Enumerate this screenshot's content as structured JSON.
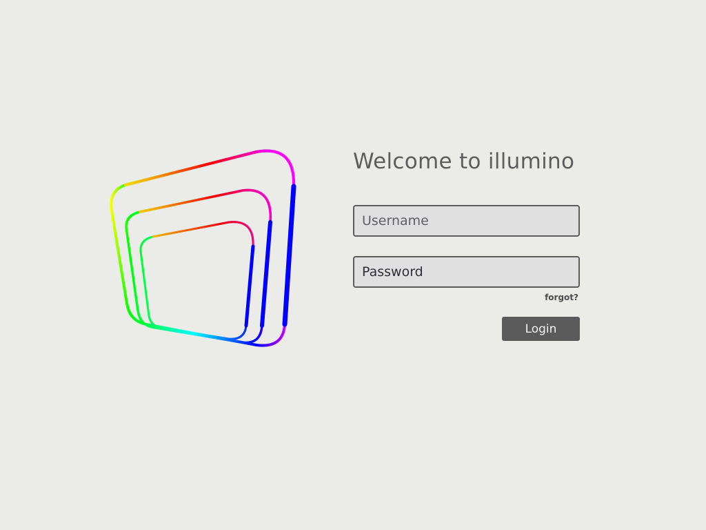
{
  "logo": {
    "icon": "rainbow-nested-squares-logo",
    "colors": [
      "#ffff00",
      "#00ff00",
      "#00ffff",
      "#0000ff",
      "#ff00ff",
      "#ff0000",
      "#ff9900"
    ]
  },
  "login": {
    "title": "Welcome to illumino",
    "username_placeholder": "Username",
    "password_placeholder": "Password",
    "forgot_label": "forgot?",
    "login_label": "Login"
  },
  "colors": {
    "background": "#ebebe7",
    "field_background": "#e0e0e0",
    "field_border": "#5b5b5b",
    "button_background": "#5b5b5b",
    "title_text": "#5d5d5d"
  }
}
